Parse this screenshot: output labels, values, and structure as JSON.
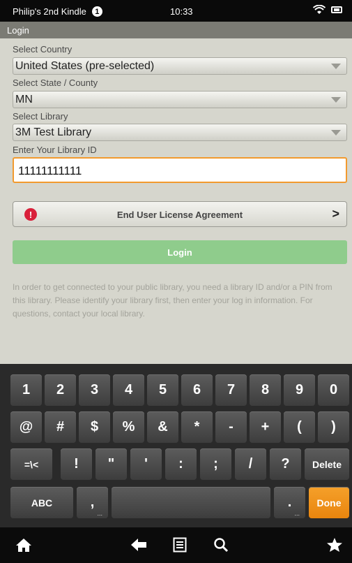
{
  "status_bar": {
    "device_name": "Philip's 2nd Kindle",
    "notification_count": "1",
    "time": "10:33"
  },
  "screen_title": "Login",
  "form": {
    "country_label": "Select Country",
    "country_value": "United States (pre-selected)",
    "state_label": "Select State / County",
    "state_value": "MN",
    "library_label": "Select Library",
    "library_value": "3M Test Library",
    "library_id_label": "Enter Your Library ID",
    "library_id_value": "11111111111",
    "eula_label": "End User License Agreement",
    "login_label": "Login",
    "info_text": "In order to get connected to your public library, you need a library ID and/or a PIN from this library. Please identify your library first, then enter your log in information. For questions, contact your local library."
  },
  "keyboard": {
    "row1": [
      "1",
      "2",
      "3",
      "4",
      "5",
      "6",
      "7",
      "8",
      "9",
      "0"
    ],
    "row2": [
      "@",
      "#",
      "$",
      "%",
      "&",
      "*",
      "-",
      "+",
      "(",
      ")"
    ],
    "row3": [
      "=\\<",
      "!",
      "\"",
      "'",
      ":",
      ";",
      "/",
      "?",
      "Delete"
    ],
    "row4": [
      "ABC",
      ",",
      "",
      ".",
      "Done"
    ],
    "comma_sub": "...",
    "period_sub": "...",
    "done_color": "#f0921f"
  },
  "nav_icons": [
    "home-icon",
    "back-icon",
    "menu-icon",
    "search-icon",
    "favorites-icon"
  ],
  "colors": {
    "accent_orange": "#f29a2e",
    "login_green": "#8fcc8c",
    "alert_red": "#d9203a"
  }
}
